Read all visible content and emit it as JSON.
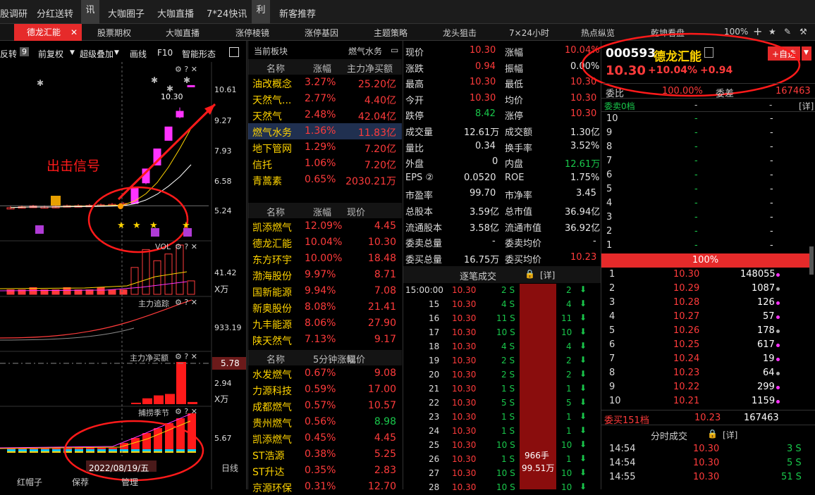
{
  "topbar": {
    "items": [
      "股调研",
      "分红送转",
      "讯",
      "大咖圈子",
      "大咖直播",
      "7*24快讯",
      "利",
      "新客推荐"
    ]
  },
  "tabs": {
    "active": "德龙汇能",
    "items": [
      "股票期权",
      "大咖直播",
      "涨停棱镜",
      "涨停基因",
      "主题策略",
      "龙头狙击",
      "7×24小时",
      "热点纵览",
      "乾坤看盘"
    ],
    "zoom": "100%"
  },
  "chart_toolbar": {
    "items": [
      "反转",
      "前复权",
      "超级叠加",
      "画线",
      "F10",
      "智能形态"
    ],
    "badge": "9"
  },
  "kline": {
    "yticks": [
      "10.61",
      "9.27",
      "7.93",
      "6.58",
      "5.24"
    ],
    "price_label": "10.30",
    "signal_label": "出击信号",
    "chart_data": {
      "type": "candlestick",
      "candles": [
        {
          "o": 5.82,
          "c": 5.85,
          "h": 5.9,
          "l": 5.8
        },
        {
          "o": 5.84,
          "c": 5.88,
          "h": 5.92,
          "l": 5.82
        },
        {
          "o": 5.86,
          "c": 5.9,
          "h": 5.95,
          "l": 5.84
        },
        {
          "o": 5.88,
          "c": 5.86,
          "h": 5.92,
          "l": 5.83
        },
        {
          "o": 5.86,
          "c": 5.89,
          "h": 5.93,
          "l": 5.84
        },
        {
          "o": 5.88,
          "c": 5.92,
          "h": 5.96,
          "l": 5.86
        },
        {
          "o": 5.92,
          "c": 5.9,
          "h": 5.97,
          "l": 5.88
        },
        {
          "o": 5.9,
          "c": 5.93,
          "h": 5.98,
          "l": 5.88
        },
        {
          "o": 5.92,
          "c": 5.95,
          "h": 6.0,
          "l": 5.9
        },
        {
          "o": 5.95,
          "c": 5.97,
          "h": 6.02,
          "l": 5.92
        },
        {
          "o": 5.97,
          "c": 6.0,
          "h": 6.05,
          "l": 5.95
        },
        {
          "o": 6.0,
          "c": 6.6,
          "h": 6.6,
          "l": 6.0
        },
        {
          "o": 6.75,
          "c": 7.26,
          "h": 7.26,
          "l": 6.7
        },
        {
          "o": 7.4,
          "c": 7.99,
          "h": 7.99,
          "l": 7.4
        },
        {
          "o": 8.3,
          "c": 8.79,
          "h": 8.79,
          "l": 8.3
        },
        {
          "o": 9.15,
          "c": 9.36,
          "h": 9.5,
          "l": 9.1
        },
        {
          "o": 10.3,
          "c": 10.3,
          "h": 10.3,
          "l": 10.3
        }
      ]
    }
  },
  "vol": {
    "title": "VOL",
    "yticks": [
      "41.42",
      "X万"
    ],
    "chart_data": {
      "type": "bar",
      "values": [
        2,
        2,
        3,
        2,
        2,
        3,
        2,
        2,
        3,
        2,
        2,
        12,
        20,
        15,
        18,
        22,
        6
      ]
    }
  },
  "zhuli": {
    "title": "主力追踪",
    "ytick": "933.19"
  },
  "netbuy": {
    "title": "主力净买额",
    "value_box": "5.78",
    "yticks": [
      "2.94",
      "X万"
    ],
    "chart_data": {
      "type": "bar",
      "values": [
        0,
        0,
        0,
        0,
        0,
        0,
        0,
        0,
        0,
        0,
        0,
        0.2,
        0.8,
        1.2,
        1.4,
        5.78,
        0.3
      ]
    }
  },
  "season": {
    "title": "捕捞季节",
    "ytick": "5.67",
    "date": "2022/08/19/五",
    "period": "日线"
  },
  "bottom_left": [
    "红帽子",
    "保荐",
    "管理"
  ],
  "sector": {
    "title": "当前板块",
    "subtitle": "燃气水务",
    "cols": [
      "名称",
      "涨幅",
      "主力净买额"
    ],
    "rows": [
      {
        "name": "油改概念",
        "chg": "3.27%",
        "net": "25.20亿"
      },
      {
        "name": "天然气...",
        "chg": "2.77%",
        "net": "4.40亿"
      },
      {
        "name": "天然气",
        "chg": "2.48%",
        "net": "42.04亿"
      },
      {
        "name": "燃气水务",
        "chg": "1.36%",
        "net": "11.83亿"
      },
      {
        "name": "地下管网",
        "chg": "1.29%",
        "net": "7.20亿"
      },
      {
        "name": "信托",
        "chg": "1.06%",
        "net": "7.20亿"
      },
      {
        "name": "青蒿素",
        "chg": "0.65%",
        "net": "2030.21万"
      }
    ]
  },
  "stocks": {
    "cols": [
      "名称",
      "涨幅",
      "现价"
    ],
    "rows": [
      {
        "name": "凯添燃气",
        "chg": "12.09%",
        "price": "4.45"
      },
      {
        "name": "德龙汇能",
        "chg": "10.04%",
        "price": "10.30"
      },
      {
        "name": "东方环宇",
        "chg": "10.00%",
        "price": "18.48"
      },
      {
        "name": "渤海股份",
        "chg": "9.97%",
        "price": "8.71"
      },
      {
        "name": "国新能源",
        "chg": "9.94%",
        "price": "7.08"
      },
      {
        "name": "新奥股份",
        "chg": "8.08%",
        "price": "21.41"
      },
      {
        "name": "九丰能源",
        "chg": "8.06%",
        "price": "27.90"
      },
      {
        "name": "陕天然气",
        "chg": "7.13%",
        "price": "9.17"
      }
    ]
  },
  "fivemin": {
    "cols": [
      "名称",
      "5分钟涨幅",
      "现价"
    ],
    "rows": [
      {
        "name": "水发燃气",
        "chg": "0.67%",
        "price": "9.08"
      },
      {
        "name": "力源科技",
        "chg": "0.59%",
        "price": "17.00"
      },
      {
        "name": "成都燃气",
        "chg": "0.57%",
        "price": "10.57"
      },
      {
        "name": "贵州燃气",
        "chg": "0.56%",
        "price": "8.98"
      },
      {
        "name": "凯添燃气",
        "chg": "0.45%",
        "price": "4.45"
      },
      {
        "name": "ST浩源",
        "chg": "0.38%",
        "price": "5.25"
      },
      {
        "name": "ST升达",
        "chg": "0.35%",
        "price": "2.83"
      },
      {
        "name": "京源环保",
        "chg": "0.31%",
        "price": "12.70"
      }
    ]
  },
  "quote": {
    "left": [
      {
        "k": "现价",
        "v": "10.30"
      },
      {
        "k": "涨跌",
        "v": "0.94"
      },
      {
        "k": "最高",
        "v": "10.30"
      },
      {
        "k": "今开",
        "v": "10.30"
      },
      {
        "k": "跌停",
        "v": "8.42"
      },
      {
        "k": "成交量",
        "v": "12.61万"
      },
      {
        "k": "量比",
        "v": "0.34"
      },
      {
        "k": "外盘",
        "v": "0"
      },
      {
        "k": "EPS ②",
        "v": "0.0520"
      },
      {
        "k": "市盈率",
        "v": "99.70"
      },
      {
        "k": "总股本",
        "v": "3.59亿"
      },
      {
        "k": "流通股本",
        "v": "3.58亿"
      },
      {
        "k": "委卖总量",
        "v": "-"
      },
      {
        "k": "委买总量",
        "v": "16.75万"
      }
    ],
    "right": [
      {
        "k": "涨幅",
        "v": "10.04%"
      },
      {
        "k": "振幅",
        "v": "0.00%"
      },
      {
        "k": "最低",
        "v": "10.30"
      },
      {
        "k": "均价",
        "v": "10.30"
      },
      {
        "k": "涨停",
        "v": "10.30"
      },
      {
        "k": "成交额",
        "v": "1.30亿"
      },
      {
        "k": "换手率",
        "v": "3.52%"
      },
      {
        "k": "内盘",
        "v": "12.61万"
      },
      {
        "k": "ROE",
        "v": "1.75%"
      },
      {
        "k": "市净率",
        "v": "3.45"
      },
      {
        "k": "总市值",
        "v": "36.94亿"
      },
      {
        "k": "流通市值",
        "v": "36.92亿"
      },
      {
        "k": "委卖均价",
        "v": "-"
      },
      {
        "k": "委买均价",
        "v": "10.23"
      }
    ]
  },
  "ticks": {
    "title": "逐笔成交",
    "detail": "[详]",
    "bar_vol": "966手",
    "bar_amt": "99.51万",
    "rows": [
      {
        "t": "15:00:00",
        "p": "10.30",
        "v": "2 S",
        "n": "2"
      },
      {
        "t": "15",
        "p": "10.30",
        "v": "4 S",
        "n": "4"
      },
      {
        "t": "16",
        "p": "10.30",
        "v": "11 S",
        "n": "11"
      },
      {
        "t": "17",
        "p": "10.30",
        "v": "10 S",
        "n": "10"
      },
      {
        "t": "18",
        "p": "10.30",
        "v": "4 S",
        "n": "4"
      },
      {
        "t": "19",
        "p": "10.30",
        "v": "2 S",
        "n": "2"
      },
      {
        "t": "20",
        "p": "10.30",
        "v": "2 S",
        "n": "2"
      },
      {
        "t": "21",
        "p": "10.30",
        "v": "1 S",
        "n": "1"
      },
      {
        "t": "22",
        "p": "10.30",
        "v": "5 S",
        "n": "5"
      },
      {
        "t": "23",
        "p": "10.30",
        "v": "1 S",
        "n": "1"
      },
      {
        "t": "24",
        "p": "10.30",
        "v": "1 S",
        "n": "1"
      },
      {
        "t": "25",
        "p": "10.30",
        "v": "10 S",
        "n": "10"
      },
      {
        "t": "26",
        "p": "10.30",
        "v": "1 S",
        "n": "1"
      },
      {
        "t": "27",
        "p": "10.30",
        "v": "10 S",
        "n": "10"
      },
      {
        "t": "28",
        "p": "10.30",
        "v": "10 S",
        "n": "10"
      }
    ]
  },
  "stock": {
    "code": "000593",
    "name": "德龙汇能",
    "price": "10.30",
    "pct": "+10.04%",
    "chg": "+0.94",
    "add_btn": "+自选",
    "weibi_k": "委比",
    "weibi_v": "100.00%",
    "weicha_k": "委差",
    "weicha_v": "167463",
    "sell_title": "委卖0档",
    "sell_dash": "-",
    "detail": "[详]"
  },
  "orderbook": {
    "sell_levels": [
      "10",
      "9",
      "8",
      "7",
      "6",
      "5",
      "4",
      "3",
      "2",
      "1"
    ],
    "pct_bar": "100%",
    "buys": [
      {
        "l": "1",
        "p": "10.30",
        "v": "148055"
      },
      {
        "l": "2",
        "p": "10.29",
        "v": "1087"
      },
      {
        "l": "3",
        "p": "10.28",
        "v": "126"
      },
      {
        "l": "4",
        "p": "10.27",
        "v": "57"
      },
      {
        "l": "5",
        "p": "10.26",
        "v": "178"
      },
      {
        "l": "6",
        "p": "10.25",
        "v": "617"
      },
      {
        "l": "7",
        "p": "10.24",
        "v": "19"
      },
      {
        "l": "8",
        "p": "10.23",
        "v": "64"
      },
      {
        "l": "9",
        "p": "10.22",
        "v": "299"
      },
      {
        "l": "10",
        "p": "10.21",
        "v": "1159"
      }
    ],
    "buy_total_k": "委买151档",
    "buy_total_p": "10.23",
    "buy_total_v": "167463"
  },
  "timesales": {
    "title": "分时成交",
    "detail": "[详]",
    "rows": [
      {
        "t": "14:54",
        "p": "10.30",
        "v": "3 S"
      },
      {
        "t": "14:54",
        "p": "10.30",
        "v": "5 S"
      },
      {
        "t": "14:55",
        "p": "10.30",
        "v": "51 S"
      }
    ]
  },
  "colors": {
    "up": "#ff3b3b",
    "down": "#19c84b",
    "accent": "#e62a2a",
    "annot": "#ff1a1a",
    "magenta": "#ff33ff"
  }
}
